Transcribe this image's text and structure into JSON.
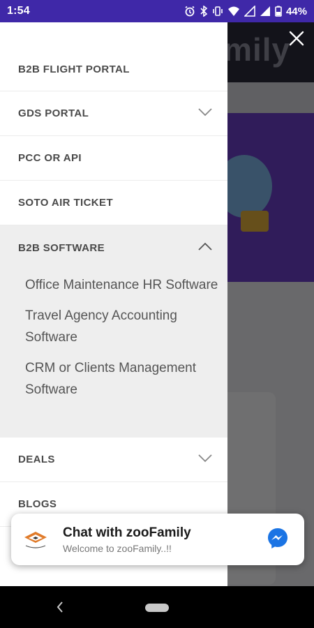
{
  "status_bar": {
    "time": "1:54",
    "battery": "44%"
  },
  "background": {
    "logo_text": "zoofamily"
  },
  "drawer": {
    "items": [
      {
        "label": "B2B FLIGHT PORTAL"
      },
      {
        "label": "GDS PORTAL",
        "chevron": "chevron-down-icon"
      },
      {
        "label": "PCC OR API"
      },
      {
        "label": "SOTO AIR TICKET"
      },
      {
        "label": "B2B SOFTWARE",
        "chevron": "chevron-up-icon",
        "expanded": true,
        "subitems": [
          "Office Maintenance HR Software",
          "Travel Agency Accounting Software",
          "CRM or Clients Management Software"
        ]
      },
      {
        "label": "DEALS",
        "chevron": "chevron-down-icon"
      },
      {
        "label": "BLOGS"
      }
    ]
  },
  "chat": {
    "title": "Chat with zooFamily",
    "subtitle": "Welcome to zooFamily..!!"
  },
  "colors": {
    "status_bar": "#3f28a8",
    "messenger": "#1b74e4",
    "menu_text": "#4a4a4a"
  }
}
